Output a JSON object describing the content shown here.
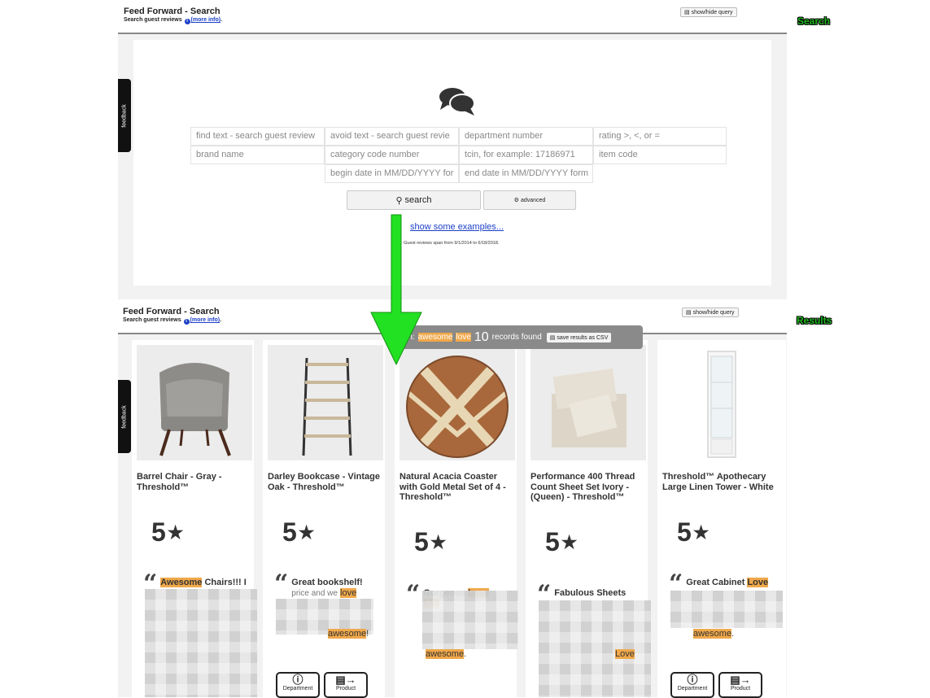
{
  "app": {
    "title": "Feed Forward - Search",
    "subtitle_prefix": "Search guest reviews ",
    "more_info": "(more info)",
    "suffix": ".",
    "show_hide": "show/hide query"
  },
  "stage_labels": {
    "search": "Search",
    "results": "Results"
  },
  "feedback_label": "feedback",
  "search_form": {
    "fields": [
      "find text - search guest review",
      "avoid text - search guest revie",
      "department number",
      "rating >, <, or =",
      "brand name",
      "category code number",
      "tcin, for example: 17186971",
      "item code",
      "begin date in MM/DD/YYYY for",
      "end date in MM/DD/YYYY form"
    ],
    "search_button": "search",
    "advanced_button": "advanced",
    "examples_link": "show some examples...",
    "span_note": "Guest reviews span from 9/1/2014 to 6/18/2018."
  },
  "results": {
    "banner_prefix": "rch:",
    "query_terms": [
      "awesome",
      "love"
    ],
    "count": "10",
    "count_label": "records found",
    "csv_button": "save results as CSV",
    "items": [
      {
        "title": "Barrel Chair - Gray - Threshold™",
        "rating": "5",
        "quote_title_hl": "Awesome",
        "quote_title_rest": " Chairs!!! I"
      },
      {
        "title": "Darley Bookcase - Vintage Oak - Threshold™",
        "rating": "5",
        "quote_title": "Great bookshelf!",
        "line2": "price and we",
        "hl1": "love",
        "hl2": "awesome",
        "tail": "!"
      },
      {
        "title": "Natural Acacia Coaster with Gold Metal Set of 4 - Threshold™",
        "rating": "5",
        "quote_title": "Gorgeous ",
        "hl1": "Love",
        "hl2": "love",
        "hl3": "awesome",
        "tail": "."
      },
      {
        "title": "Performance 400 Thread Count Sheet Set Ivory - (Queen) - Threshold™",
        "rating": "5",
        "quote_title": "Fabulous Sheets",
        "hl1": "Love"
      },
      {
        "title": "Threshold™ Apothecary Large Linen Tower - White",
        "rating": "5",
        "quote_title": "Great Cabinet ",
        "hl1": "Love",
        "hl2": "awesome",
        "tail": "."
      }
    ],
    "buttons": {
      "department": "Department",
      "product": "Product"
    }
  }
}
